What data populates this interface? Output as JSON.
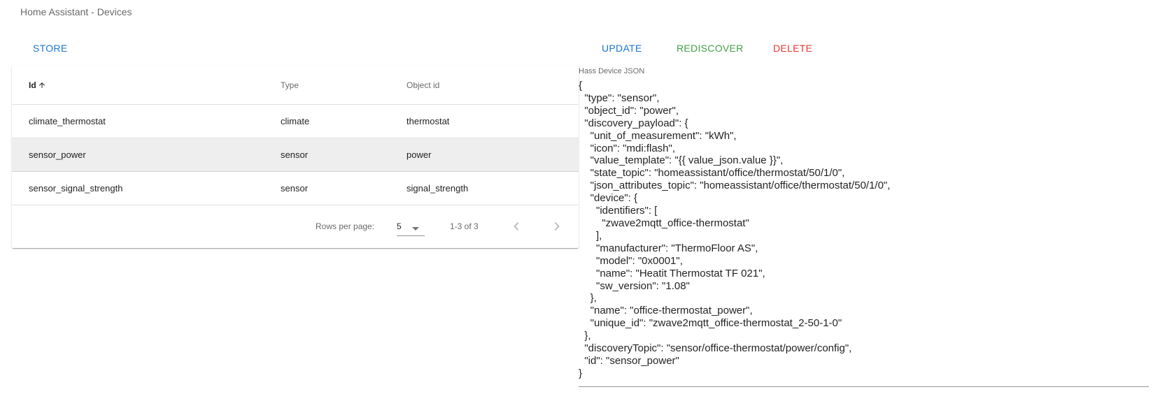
{
  "page_title": "Home Assistant - Devices",
  "toolbar": {
    "store_label": "STORE",
    "update_label": "UPDATE",
    "rediscover_label": "REDISCOVER",
    "delete_label": "DELETE"
  },
  "colors": {
    "primary": "#1976d2",
    "success": "#43a047",
    "danger": "#e53935"
  },
  "table": {
    "headers": [
      "Id",
      "Type",
      "Object id"
    ],
    "sort_icon": "arrow-up-icon",
    "rows": [
      {
        "id": "climate_thermostat",
        "type": "climate",
        "object_id": "thermostat"
      },
      {
        "id": "sensor_power",
        "type": "sensor",
        "object_id": "power"
      },
      {
        "id": "sensor_signal_strength",
        "type": "sensor",
        "object_id": "signal_strength"
      }
    ],
    "footer": {
      "rows_per_page_label": "Rows per page:",
      "rows_per_page_value": "5",
      "page_range": "1-3 of 3"
    }
  },
  "json_editor": {
    "label": "Hass Device JSON",
    "value": "{\n  \"type\": \"sensor\",\n  \"object_id\": \"power\",\n  \"discovery_payload\": {\n    \"unit_of_measurement\": \"kWh\",\n    \"icon\": \"mdi:flash\",\n    \"value_template\": \"{{ value_json.value }}\",\n    \"state_topic\": \"homeassistant/office/thermostat/50/1/0\",\n    \"json_attributes_topic\": \"homeassistant/office/thermostat/50/1/0\",\n    \"device\": {\n      \"identifiers\": [\n        \"zwave2mqtt_office-thermostat\"\n      ],\n      \"manufacturer\": \"ThermoFloor AS\",\n      \"model\": \"0x0001\",\n      \"name\": \"Heatit Thermostat TF 021\",\n      \"sw_version\": \"1.08\"\n    },\n    \"name\": \"office-thermostat_power\",\n    \"unique_id\": \"zwave2mqtt_office-thermostat_2-50-1-0\"\n  },\n  \"discoveryTopic\": \"sensor/office-thermostat/power/config\",\n  \"id\": \"sensor_power\"\n}"
  }
}
